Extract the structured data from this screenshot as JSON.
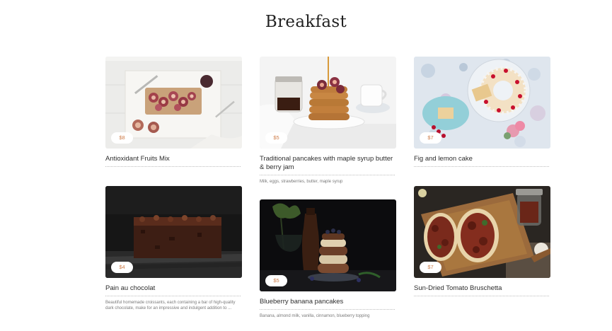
{
  "page": {
    "title": "Breakfast"
  },
  "items": [
    {
      "name": "Antioxidant Fruits Mix",
      "price": "$8",
      "description": ""
    },
    {
      "name": "Traditional pancakes with maple syrup butter & berry jam",
      "price": "$5",
      "description": "Milk, eggs, strawberries, butter, maple syrup"
    },
    {
      "name": "Fig and lemon cake",
      "price": "$7",
      "description": ""
    },
    {
      "name": "Pain au chocolat",
      "price": "$4",
      "description": "Beautiful homemade croissants, each containing a bar of high-quality dark chocolate, make for an impressive and indulgent addition to ..."
    },
    {
      "name": "Blueberry banana pancakes",
      "price": "$5",
      "description": "Banana, almond milk, vanilla, cinnamon, blueberry topping"
    },
    {
      "name": "Sun-Dried Tomato Bruschetta",
      "price": "$7",
      "description": ""
    }
  ]
}
